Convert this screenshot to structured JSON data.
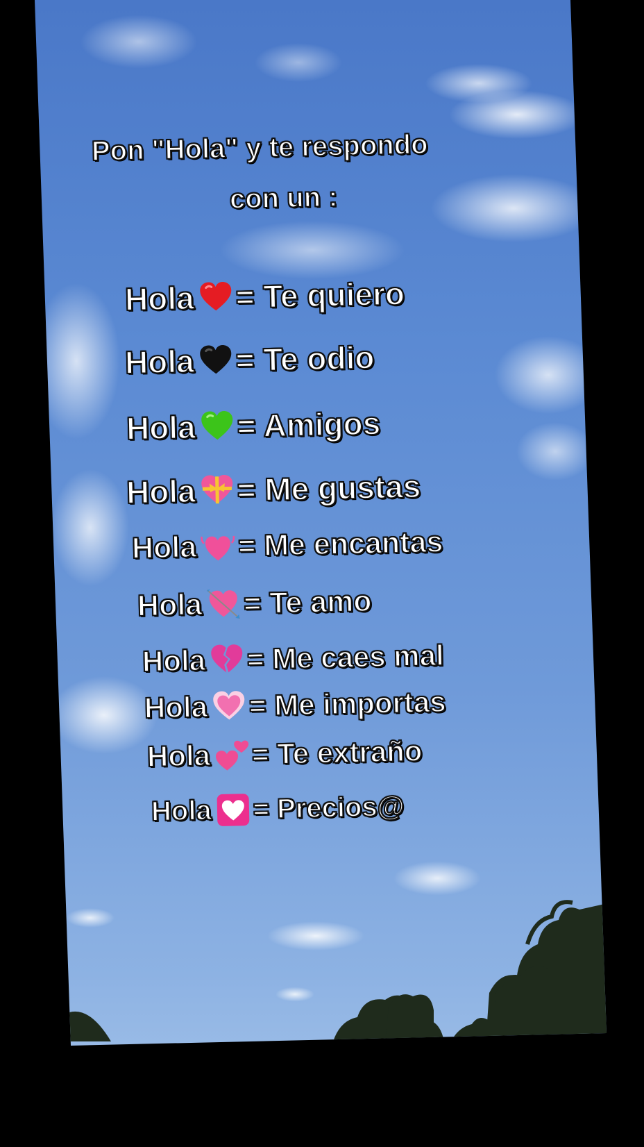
{
  "header": {
    "line1": "Pon \"Hola\" y te respondo",
    "line2": "con un :"
  },
  "rows": [
    {
      "word": "Hola",
      "icon": "red-heart-icon",
      "color": "#e51c23",
      "meaning": "= Te quiero"
    },
    {
      "word": "Hola",
      "icon": "black-heart-icon",
      "color": "#111111",
      "meaning": "= Te odio"
    },
    {
      "word": "Hola",
      "icon": "green-heart-icon",
      "color": "#3cc41a",
      "meaning": "= Amigos"
    },
    {
      "word": "Hola",
      "icon": "heart-with-ribbon-icon",
      "color": "#f0579a",
      "meaning": "= Me gustas"
    },
    {
      "word": "Hola",
      "icon": "beating-heart-icon",
      "color": "#f0509a",
      "meaning": "= Me encantas"
    },
    {
      "word": "Hola",
      "icon": "heart-with-arrow-icon",
      "color": "#f0579a",
      "meaning": "= Te amo"
    },
    {
      "word": "Hola",
      "icon": "broken-heart-icon",
      "color": "#e23b9a",
      "meaning": "= Me caes mal"
    },
    {
      "word": "Hola",
      "icon": "sparkling-pink-heart-icon",
      "color": "#f270b0",
      "meaning": "= Me importas"
    },
    {
      "word": "Hola",
      "icon": "two-hearts-icon",
      "color": "#ef4c93",
      "meaning": "= Te extraño"
    },
    {
      "word": "Hola",
      "icon": "heart-decoration-icon",
      "color": "#ec2f8e",
      "meaning": "= Precios@"
    }
  ]
}
